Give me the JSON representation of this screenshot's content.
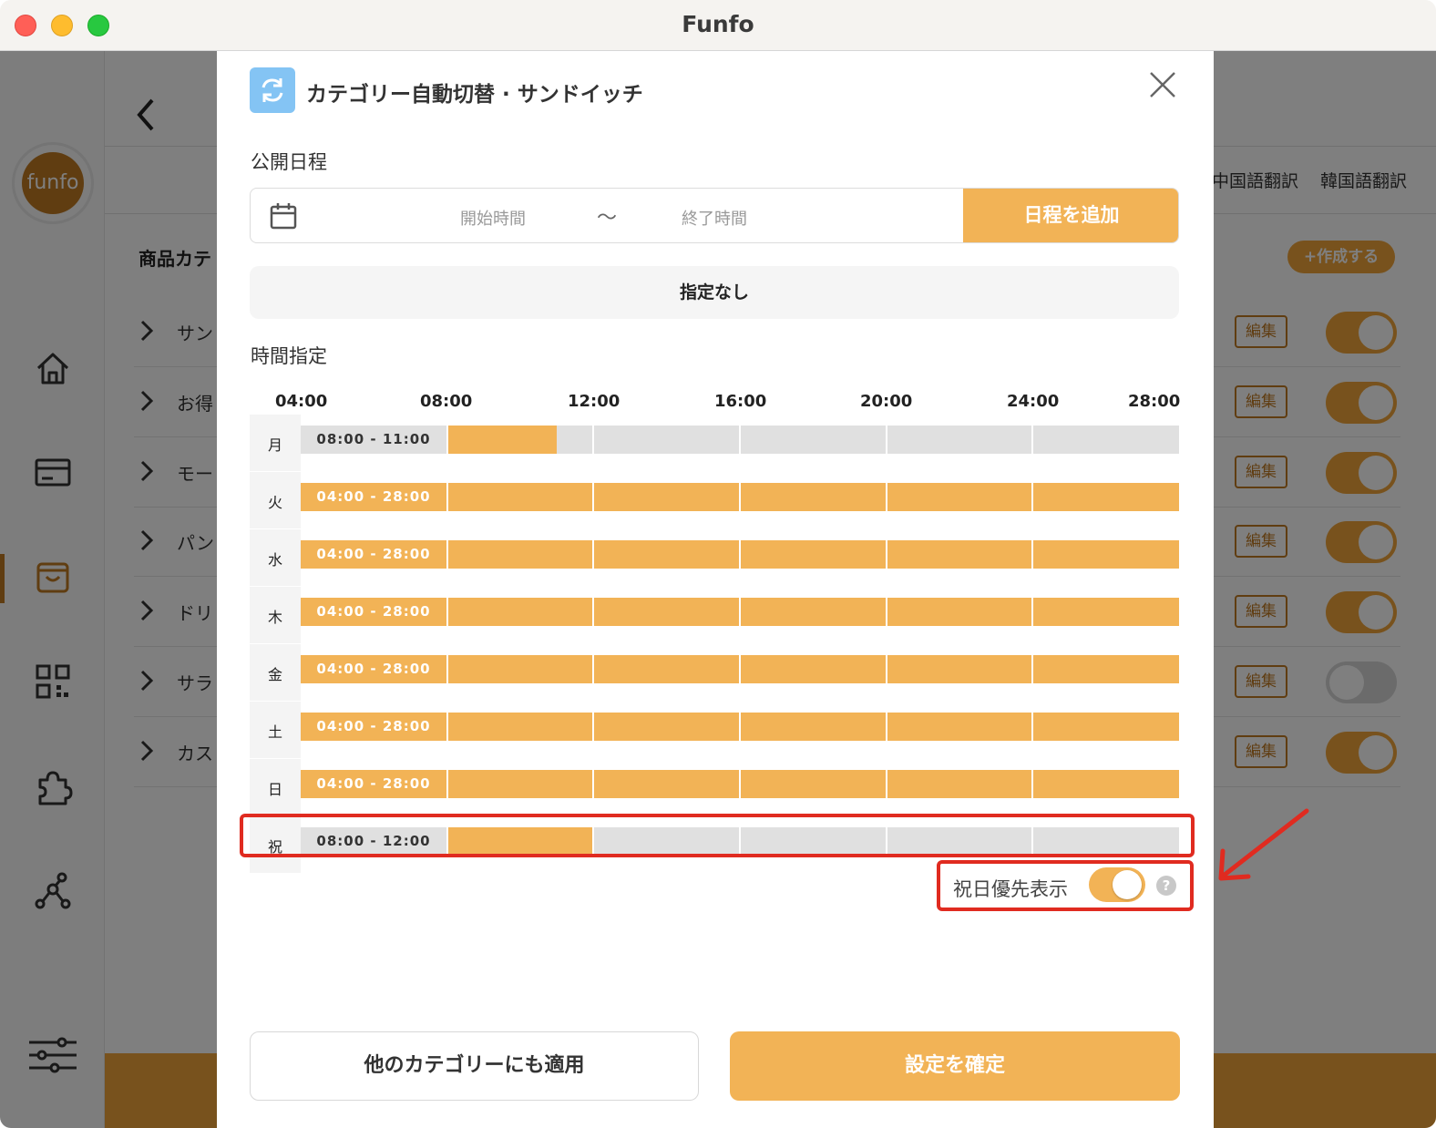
{
  "window": {
    "title": "Funfo"
  },
  "background": {
    "logo_text": "funfo",
    "tabs": [
      "中国語翻訳",
      "韓国語翻訳"
    ],
    "section_title": "商品カテ",
    "create_label": "+作成する",
    "rows": [
      {
        "label": "サン",
        "edit": "編集",
        "enabled": true
      },
      {
        "label": "お得",
        "edit": "編集",
        "enabled": true
      },
      {
        "label": "モー",
        "edit": "編集",
        "enabled": true
      },
      {
        "label": "パン",
        "edit": "編集",
        "enabled": true
      },
      {
        "label": "ドリ",
        "edit": "編集",
        "enabled": true
      },
      {
        "label": "サラ",
        "edit": "編集",
        "enabled": false
      },
      {
        "label": "カス",
        "edit": "編集",
        "enabled": true
      }
    ]
  },
  "modal": {
    "title": "カテゴリー自動切替 · サンドイッチ",
    "publish_label": "公開日程",
    "start_placeholder": "開始時間",
    "tilde": "〜",
    "end_placeholder": "終了時間",
    "add_schedule": "日程を追加",
    "no_spec": "指定なし",
    "time_label": "時間指定",
    "ticks": [
      "04:00",
      "08:00",
      "12:00",
      "16:00",
      "20:00",
      "24:00",
      "28:00"
    ],
    "schedule": [
      {
        "day": "月",
        "range": "08:00 - 11:00",
        "start": 8,
        "end": 11
      },
      {
        "day": "火",
        "range": "04:00 - 28:00",
        "start": 4,
        "end": 28
      },
      {
        "day": "水",
        "range": "04:00 - 28:00",
        "start": 4,
        "end": 28
      },
      {
        "day": "木",
        "range": "04:00 - 28:00",
        "start": 4,
        "end": 28
      },
      {
        "day": "金",
        "range": "04:00 - 28:00",
        "start": 4,
        "end": 28
      },
      {
        "day": "土",
        "range": "04:00 - 28:00",
        "start": 4,
        "end": 28
      },
      {
        "day": "日",
        "range": "04:00 - 28:00",
        "start": 4,
        "end": 28
      },
      {
        "day": "祝",
        "range": "08:00 - 12:00",
        "start": 8,
        "end": 12
      }
    ],
    "holiday_priority_label": "祝日優先表示",
    "holiday_priority_on": true,
    "help": "?",
    "apply_other": "他のカテゴリーにも適用",
    "confirm": "設定を確定"
  },
  "colors": {
    "accent": "#f2b356",
    "highlight": "#e02b20",
    "icon_bg": "#84c4f4"
  }
}
